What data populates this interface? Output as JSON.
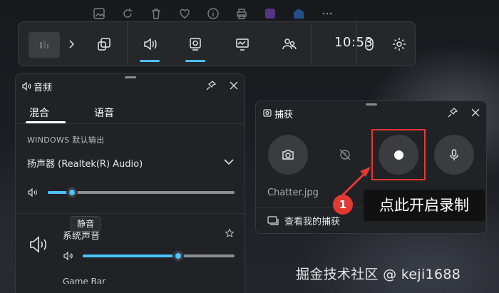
{
  "app_strip": {
    "icons": [
      "image-edit-icon",
      "refresh-icon",
      "trash-icon",
      "heart-icon",
      "info-icon",
      "print-icon",
      "app-purple-icon",
      "app-blue-icon",
      "more-icon"
    ]
  },
  "gamebar": {
    "time": "10:53",
    "widgets": [
      "capture-window-icon",
      "audio-icon",
      "capture-icon",
      "performance-icon",
      "social-icon",
      "mouse-icon",
      "settings-icon"
    ],
    "active_widgets": [
      "audio",
      "capture"
    ],
    "accent": "#4cc2ff"
  },
  "audio_panel": {
    "title": "音频",
    "tabs": [
      {
        "label": "混合",
        "selected": true
      },
      {
        "label": "语音",
        "selected": false
      }
    ],
    "output_section_label": "WINDOWS 默认输出",
    "device_name": "扬声器 (Realtek(R) Audio)",
    "master_volume": 0.13,
    "tooltip": "静音",
    "app_label": "系统声音",
    "app_volume": 0.63,
    "next_item_partial": "Game Bar"
  },
  "capture_panel": {
    "title": "捕获",
    "buttons": [
      "screenshot-button",
      "record-last-button",
      "record-button",
      "mic-button"
    ],
    "last_file": "Chatter.jpg",
    "gallery_link": "查看我的捕获"
  },
  "annotation": {
    "number": "1",
    "text": "点此开启录制",
    "color": "#e23a32"
  },
  "watermark": "掘金技术社区 @ keji1688"
}
